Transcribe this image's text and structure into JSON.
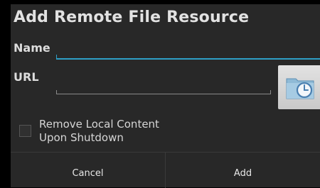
{
  "dialog": {
    "title": "Add Remote File Resource",
    "name_label": "Name",
    "name_value": "",
    "url_label": "URL",
    "url_value": "",
    "browse_icon": "folder-clock-icon",
    "checkbox": {
      "line1": "Remove Local Content",
      "line2": "Upon Shutdown",
      "checked": false
    },
    "buttons": {
      "cancel": "Cancel",
      "add": "Add"
    }
  },
  "colors": {
    "dialog_bg": "#282828",
    "focus_accent": "#2e9fc6",
    "icon_folder": "#8fbad6",
    "icon_clock": "#4a7fb0"
  }
}
